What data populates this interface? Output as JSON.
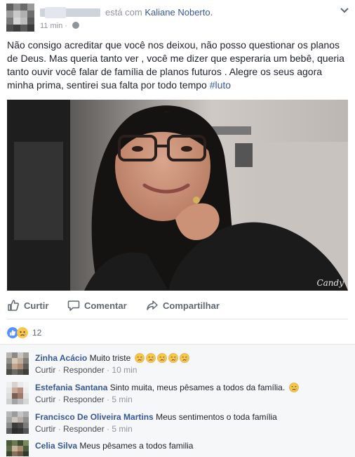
{
  "header": {
    "is_with_text": "está com",
    "tagged_name": "Kaliane Noberto.",
    "timestamp": "11 min",
    "separator": "·"
  },
  "post": {
    "text": "Não consigo acreditar que você nos deixou, não posso questionar os planos de Deus. Mas queria tanto ver , você me dizer que esperaria um bebê, queria tanto ouvir você falar de família de planos futuros . Alegre os seus agora minha prima, sentirei sua falta por todo tempo ",
    "hashtag": "#luto",
    "photo_watermark": "Candy"
  },
  "actions": {
    "like": "Curtir",
    "comment": "Comentar",
    "share": "Compartilhar"
  },
  "reactions": {
    "count": "12",
    "icons": [
      "like-icon",
      "sad-icon"
    ]
  },
  "comments": [
    {
      "author": "Zinha Acácio",
      "text": "Muito triste",
      "emoji_count": 5,
      "like": "Curtir",
      "reply": "Responder",
      "time": "10 min"
    },
    {
      "author": "Estefania Santana",
      "text": "Sinto muita, meus pêsames a todos da família.",
      "emoji_count": 1,
      "like": "Curtir",
      "reply": "Responder",
      "time": "5 min"
    },
    {
      "author": "Francisco De Oliveira Martins",
      "text": "Meus sentimentos o toda família",
      "emoji_count": 0,
      "like": "Curtir",
      "reply": "Responder",
      "time": "5 min"
    },
    {
      "author": "Celia Silva",
      "text": "Meus pêsames a todos familia",
      "emoji_count": 0,
      "like": "",
      "reply": "",
      "time": ""
    }
  ],
  "colors": {
    "link": "#365899",
    "meta": "#90949c",
    "action": "#606770",
    "comments_bg": "#f6f7f9"
  }
}
